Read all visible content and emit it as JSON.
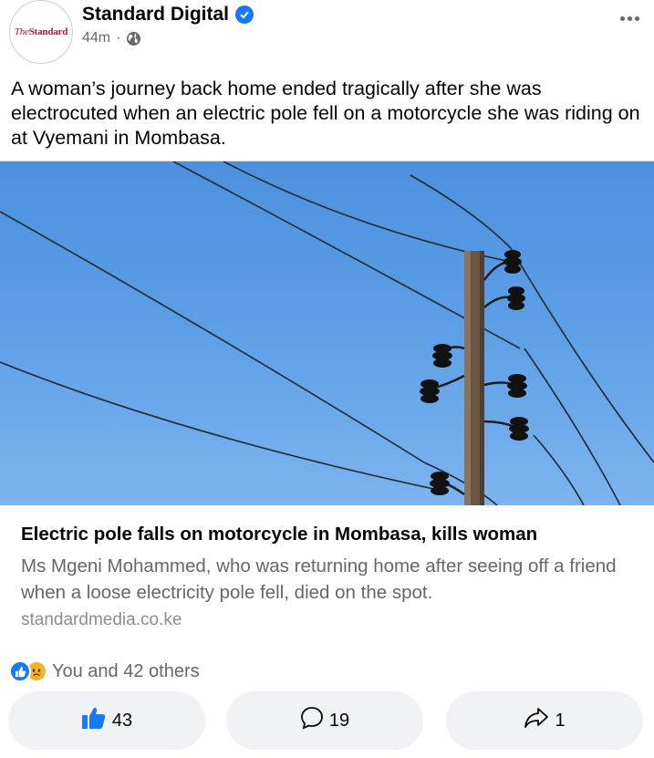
{
  "page": {
    "name": "Standard Digital",
    "avatar_text_prefix": "The",
    "avatar_text_main": "Standard",
    "time": "44m",
    "separator": "·"
  },
  "post": {
    "text": "A woman’s journey back home ended tragically after she was electrocuted when an electric pole fell on a motorcycle she was riding on at Vyemani in Mombasa."
  },
  "link": {
    "title": "Electric pole falls on motorcycle in Mombasa, kills woman",
    "description": "Ms Mgeni Mohammed, who was returning home after seeing off a friend when a loose electricity pole fell, died on the spot.",
    "domain": "standardmedia.co.ke"
  },
  "reactions": {
    "summary": "You and 42 others",
    "types": [
      "like-icon",
      "sad-icon"
    ]
  },
  "actions": {
    "like_count": "43",
    "comment_count": "19",
    "share_count": "1"
  },
  "colors": {
    "brand_blue": "#1877f2",
    "secondary_text": "#65676b",
    "button_bg": "#f0f2f5",
    "sky": "#5b9de6",
    "avatar_red": "#c8102e"
  }
}
